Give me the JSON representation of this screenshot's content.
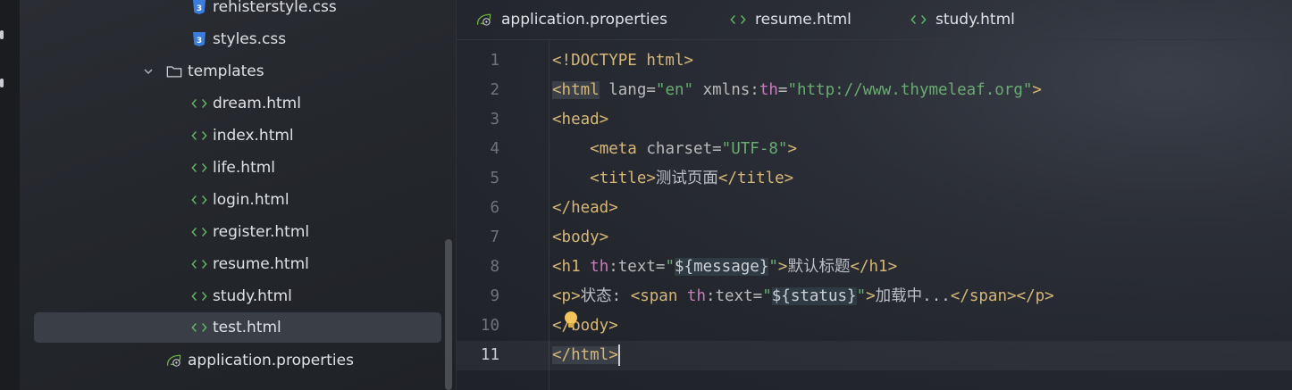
{
  "tree": {
    "items": [
      {
        "label": "rehisterstyle.css",
        "icon": "css-file-icon",
        "kind": "css"
      },
      {
        "label": "styles.css",
        "icon": "css-file-icon",
        "kind": "css"
      },
      {
        "label": "templates",
        "icon": "folder-icon",
        "kind": "folder"
      },
      {
        "label": "dream.html",
        "icon": "html-file-icon",
        "kind": "html"
      },
      {
        "label": "index.html",
        "icon": "html-file-icon",
        "kind": "html"
      },
      {
        "label": "life.html",
        "icon": "html-file-icon",
        "kind": "html"
      },
      {
        "label": "login.html",
        "icon": "html-file-icon",
        "kind": "html"
      },
      {
        "label": "register.html",
        "icon": "html-file-icon",
        "kind": "html"
      },
      {
        "label": "resume.html",
        "icon": "html-file-icon",
        "kind": "html"
      },
      {
        "label": "study.html",
        "icon": "html-file-icon",
        "kind": "html"
      },
      {
        "label": "test.html",
        "icon": "html-file-icon",
        "kind": "html",
        "selected": true
      },
      {
        "label": "application.properties",
        "icon": "spring-properties-icon",
        "kind": "properties"
      }
    ]
  },
  "tabs": [
    {
      "label": "application.properties",
      "icon": "spring-properties-icon"
    },
    {
      "label": "resume.html",
      "icon": "html-file-icon"
    },
    {
      "label": "study.html",
      "icon": "html-file-icon"
    }
  ],
  "editor": {
    "line_numbers": [
      "1",
      "2",
      "3",
      "4",
      "5",
      "6",
      "7",
      "8",
      "9",
      "10",
      "11"
    ],
    "current_line": "11",
    "lines": {
      "l1": {
        "t1": "<!DOCTYPE html>"
      },
      "l2": {
        "t1": "<html",
        "t2": " lang=",
        "t3": "\"en\"",
        "t4": " xmlns:",
        "t5": "th",
        "t6": "=",
        "t7": "\"http://www.thymeleaf.org\"",
        "t8": ">"
      },
      "l3": {
        "t1": "<head>"
      },
      "l4": {
        "t1": "<meta",
        "t2": " charset=",
        "t3": "\"UTF-8\"",
        "t4": ">"
      },
      "l5": {
        "t1": "<title>",
        "t2": "测试页面",
        "t3": "</title>"
      },
      "l6": {
        "t1": "</head>"
      },
      "l7": {
        "t1": "<body>"
      },
      "l8": {
        "t1": "<h1 ",
        "t2": "th",
        "t3": ":text=",
        "t4": "\"",
        "t5": "${message}",
        "t6": "\"",
        "t7": ">",
        "t8": "默认标题",
        "t9": "</h1>"
      },
      "l9": {
        "t1": "<p>",
        "t2": "状态: ",
        "t3": "<span ",
        "t4": "th",
        "t5": ":text=",
        "t6": "\"",
        "t7": "${status}",
        "t8": "\"",
        "t9": ">",
        "t10": "加载中...",
        "t11": "</span></p>"
      },
      "l10": {
        "t1": "</body>"
      },
      "l11": {
        "t1": "</html>"
      }
    }
  },
  "colors": {
    "tag": "#d5b778",
    "string": "#6aab73",
    "namespace": "#c77dbb",
    "html_icon": "#5fb865",
    "css_icon": "#3b7ddd",
    "spring_icon": "#6db33f"
  }
}
